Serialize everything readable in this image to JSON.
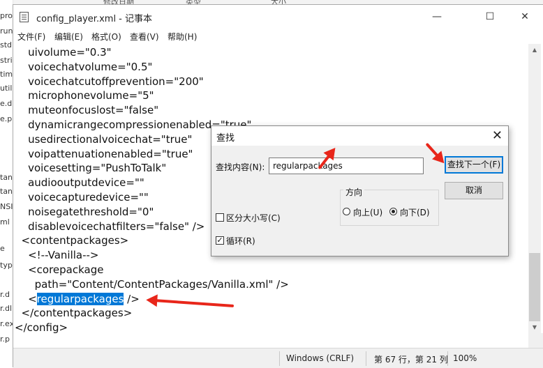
{
  "background": {
    "header_cols": [
      "修改日期",
      "类型",
      "大小"
    ],
    "left_fragments": [
      "pro",
      "run",
      "std",
      "stri",
      "tim",
      "util",
      "e.d",
      "e.p",
      "tan",
      "tan",
      "NSI",
      "ml",
      "e",
      "typ",
      "r.d",
      "r.dl",
      "r.ex",
      "r.p"
    ]
  },
  "window": {
    "title": "config_player.xml - 记事本",
    "controls": {
      "minimize": "—",
      "maximize": "☐",
      "close": "✕"
    },
    "icon": "notepad-icon"
  },
  "menu": [
    "文件(F)",
    "编辑(E)",
    "格式(O)",
    "查看(V)",
    "帮助(H)"
  ],
  "editor": {
    "lines": [
      "    uivolume=\"0.3\"",
      "    voicechatvolume=\"0.5\"",
      "    voicechatcutoffprevention=\"200\"",
      "    microphonevolume=\"5\"",
      "    muteonfocuslost=\"false\"",
      "    dynamicrangecompressionenabled=\"true\"",
      "    usedirectionalvoicechat=\"true\"",
      "    voipattenuationenabled=\"true\"",
      "    voicesetting=\"PushToTalk\"",
      "    audiooutputdevice=\"\"",
      "    voicecapturedevice=\"\"",
      "    noisegatethreshold=\"0\"",
      "    disablevoicechatfilters=\"false\" />",
      "  <contentpackages>",
      "    <!--Vanilla-->",
      "    <corepackage",
      "      path=\"Content/ContentPackages/Vanilla.xml\" />"
    ],
    "sel_prefix": "    <",
    "sel_text": "regularpackages",
    "sel_suffix": " />",
    "lines_after": [
      "  </contentpackages>",
      "</config>"
    ]
  },
  "status": {
    "encoding": "Windows (CRLF)",
    "position": "第 67 行，第 21 列",
    "zoom": "100%"
  },
  "find_dialog": {
    "title": "查找",
    "close": "✕",
    "find_label": "查找内容(N):",
    "find_value": "regularpackages",
    "find_next": "查找下一个(F)",
    "cancel": "取消",
    "direction_label": "方向",
    "up": "向上(U)",
    "down": "向下(D)",
    "direction_selected": "down",
    "match_case": "区分大小写(C)",
    "match_case_checked": false,
    "wrap": "循环(R)",
    "wrap_checked": true
  },
  "colors": {
    "selection": "#0078d7",
    "annotation_arrow": "#e8261a"
  }
}
